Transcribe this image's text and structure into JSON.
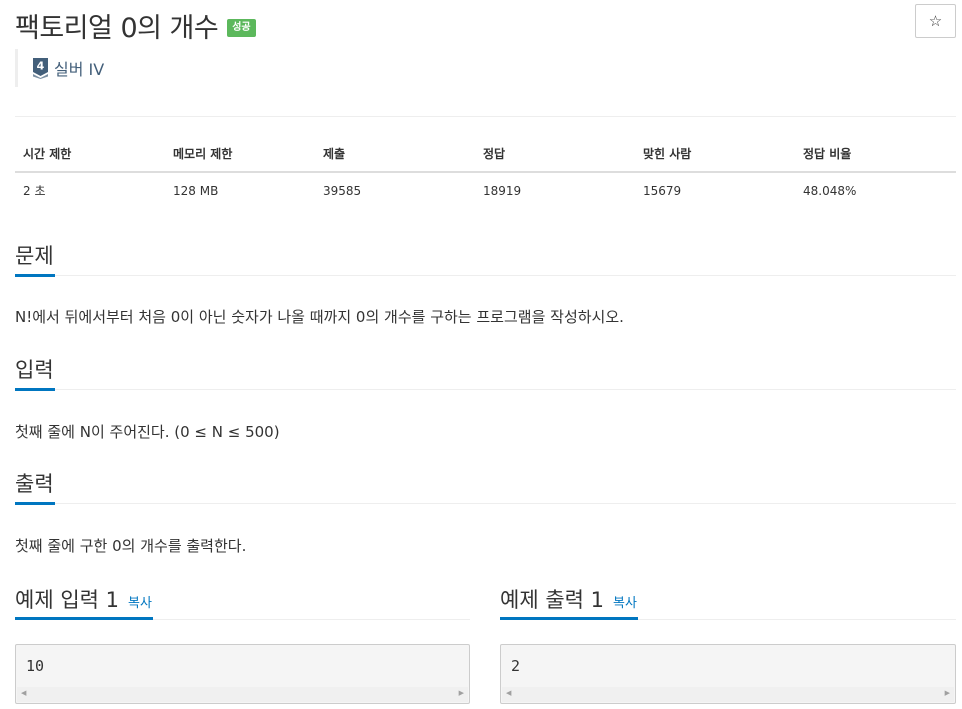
{
  "problem": {
    "title": "팩토리얼 0의 개수",
    "status_badge": "성공",
    "star_icon": "star-outline-icon",
    "tier": {
      "level": "4",
      "label": "실버 IV",
      "color": "#435f7a"
    }
  },
  "info_table": {
    "headers": [
      "시간 제한",
      "메모리 제한",
      "제출",
      "정답",
      "맞힌 사람",
      "정답 비율"
    ],
    "values": [
      "2 초",
      "128 MB",
      "39585",
      "18919",
      "15679",
      "48.048%"
    ]
  },
  "sections": {
    "description": {
      "title": "문제",
      "text": "N!에서 뒤에서부터 처음 0이 아닌 숫자가 나올 때까지 0의 개수를 구하는 프로그램을 작성하시오."
    },
    "input": {
      "title": "입력",
      "text": "첫째 줄에 N이 주어진다. (0 ≤ N ≤ 500)"
    },
    "output": {
      "title": "출력",
      "text": "첫째 줄에 구한 0의 개수를 출력한다."
    }
  },
  "samples": {
    "input": {
      "title": "예제 입력 1",
      "copy_label": "복사",
      "value": "10"
    },
    "output": {
      "title": "예제 출력 1",
      "copy_label": "복사",
      "value": "2"
    }
  },
  "colors": {
    "accent": "#0076c0",
    "success": "#5cb85c",
    "tier_silver": "#435f7a"
  }
}
